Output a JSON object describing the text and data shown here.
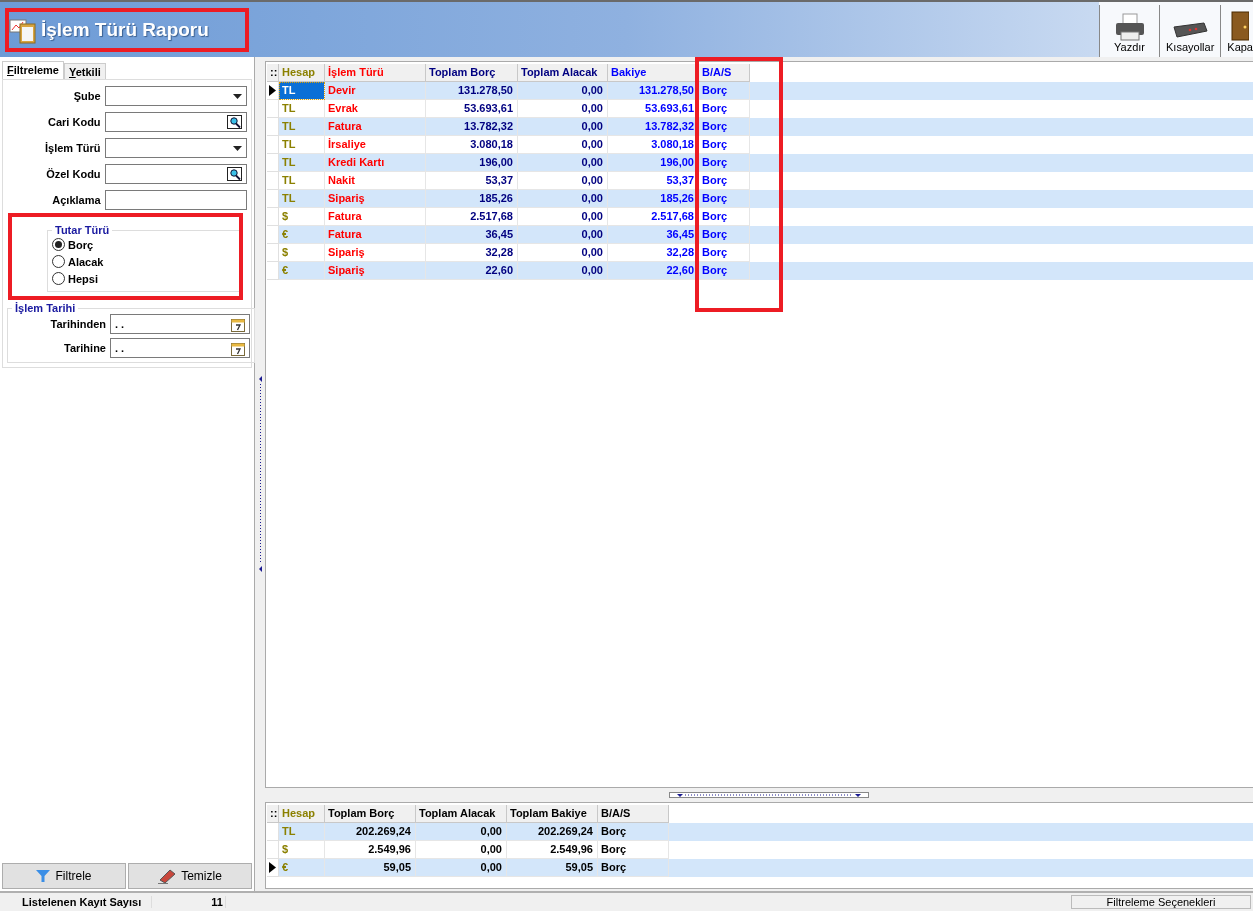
{
  "title": "İşlem Türü Raporu",
  "toolbar": [
    {
      "label": "Yazdır",
      "kind": "print"
    },
    {
      "label": "Kısayollar",
      "kind": "keyboard"
    },
    {
      "label": "Kapa",
      "kind": "door"
    }
  ],
  "tabs": [
    {
      "label": "Filtreleme",
      "selected": true
    },
    {
      "label": "Yetkili",
      "selected": false
    }
  ],
  "filters": [
    {
      "label": "Şube",
      "kind": "dropdown"
    },
    {
      "label": "Cari Kodu",
      "kind": "lookup"
    },
    {
      "label": "İşlem Türü",
      "kind": "dropdown"
    },
    {
      "label": "Özel Kodu",
      "kind": "lookup"
    },
    {
      "label": "Açıklama",
      "kind": "text"
    }
  ],
  "amount_type": {
    "title": "Tutar Türü",
    "options": [
      {
        "label": "Borç",
        "selected": true
      },
      {
        "label": "Alacak",
        "selected": false
      },
      {
        "label": "Hepsi",
        "selected": false
      }
    ]
  },
  "date_group": {
    "title": "İşlem Tarihi",
    "fields": [
      {
        "label": "Tarihinden",
        "value": ". ."
      },
      {
        "label": "Tarihine",
        "value": ". ."
      }
    ]
  },
  "buttons": [
    {
      "label": "Filtrele",
      "kind": "filter"
    },
    {
      "label": "Temizle",
      "kind": "eraser"
    }
  ],
  "grid": {
    "corner": "::",
    "columns": [
      {
        "label": "Hesap",
        "kind": "text",
        "color": "#8b8000"
      },
      {
        "label": "İşlem Türü",
        "kind": "text",
        "color": "#ff0000"
      },
      {
        "label": "Toplam Borç",
        "kind": "number",
        "color": "#000080"
      },
      {
        "label": "Toplam Alacak",
        "kind": "number",
        "color": "#000080"
      },
      {
        "label": "Bakiye",
        "kind": "number",
        "color": "#0000ff"
      },
      {
        "label": "B/A/S",
        "kind": "text",
        "color": "#0000ff"
      }
    ],
    "rows": [
      {
        "current": true,
        "cells": [
          "TL",
          "Devir",
          "131.278,50",
          "0,00",
          "131.278,50",
          "Borç"
        ]
      },
      {
        "current": false,
        "cells": [
          "TL",
          "Evrak",
          "53.693,61",
          "0,00",
          "53.693,61",
          "Borç"
        ]
      },
      {
        "current": false,
        "cells": [
          "TL",
          "Fatura",
          "13.782,32",
          "0,00",
          "13.782,32",
          "Borç"
        ]
      },
      {
        "current": false,
        "cells": [
          "TL",
          "İrsaliye",
          "3.080,18",
          "0,00",
          "3.080,18",
          "Borç"
        ]
      },
      {
        "current": false,
        "cells": [
          "TL",
          "Kredi Kartı",
          "196,00",
          "0,00",
          "196,00",
          "Borç"
        ]
      },
      {
        "current": false,
        "cells": [
          "TL",
          "Nakit",
          "53,37",
          "0,00",
          "53,37",
          "Borç"
        ]
      },
      {
        "current": false,
        "cells": [
          "TL",
          "Sipariş",
          "185,26",
          "0,00",
          "185,26",
          "Borç"
        ]
      },
      {
        "current": false,
        "cells": [
          "$",
          "Fatura",
          "2.517,68",
          "0,00",
          "2.517,68",
          "Borç"
        ]
      },
      {
        "current": false,
        "cells": [
          "€",
          "Fatura",
          "36,45",
          "0,00",
          "36,45",
          "Borç"
        ]
      },
      {
        "current": false,
        "cells": [
          "$",
          "Sipariş",
          "32,28",
          "0,00",
          "32,28",
          "Borç"
        ]
      },
      {
        "current": false,
        "cells": [
          "€",
          "Sipariş",
          "22,60",
          "0,00",
          "22,60",
          "Borç"
        ]
      }
    ]
  },
  "summary": {
    "corner": "::",
    "columns": [
      {
        "label": "Hesap",
        "kind": "text",
        "color": "#8b8000"
      },
      {
        "label": "Toplam Borç",
        "kind": "number",
        "color": "#000000"
      },
      {
        "label": "Toplam Alacak",
        "kind": "number",
        "color": "#000000"
      },
      {
        "label": "Toplam Bakiye",
        "kind": "number",
        "color": "#000000"
      },
      {
        "label": "B/A/S",
        "kind": "text",
        "color": "#000000"
      }
    ],
    "rows": [
      {
        "current": false,
        "cells": [
          "TL",
          "202.269,24",
          "0,00",
          "202.269,24",
          "Borç"
        ]
      },
      {
        "current": false,
        "cells": [
          "$",
          "2.549,96",
          "0,00",
          "2.549,96",
          "Borç"
        ]
      },
      {
        "current": true,
        "cells": [
          "€",
          "59,05",
          "0,00",
          "59,05",
          "Borç"
        ]
      }
    ]
  },
  "status_bar": {
    "label": "Listelenen Kayıt Sayısı",
    "count": "11",
    "right": "Filtreleme Seçenekleri"
  }
}
